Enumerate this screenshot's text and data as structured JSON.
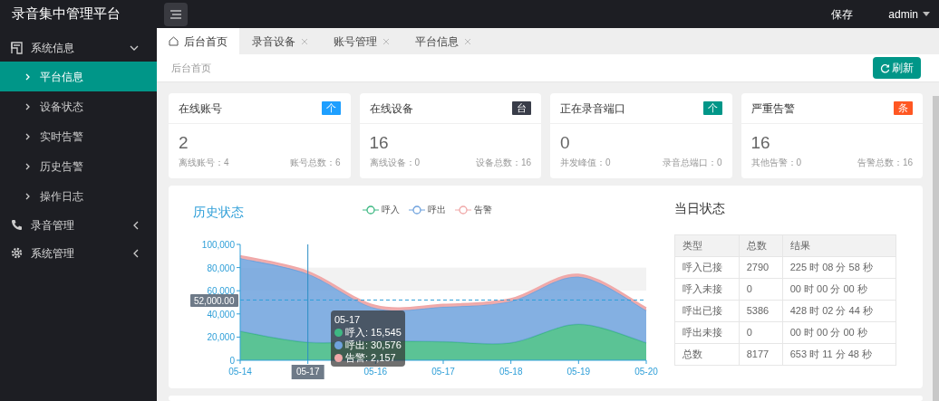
{
  "app_title": "录音集中管理平台",
  "header": {
    "save": "保存",
    "user": "admin"
  },
  "sidebar": {
    "items": [
      {
        "label": "系统信息",
        "expanded": true,
        "children": [
          {
            "label": "平台信息",
            "selected": true
          },
          {
            "label": "设备状态",
            "selected": false
          },
          {
            "label": "实时告警",
            "selected": false
          },
          {
            "label": "历史告警",
            "selected": false
          },
          {
            "label": "操作日志",
            "selected": false
          }
        ]
      },
      {
        "label": "录音管理",
        "expanded": false
      },
      {
        "label": "系统管理",
        "expanded": false
      }
    ]
  },
  "tabs": [
    {
      "label": "后台首页",
      "selected": true,
      "closable": false
    },
    {
      "label": "录音设备",
      "selected": false,
      "closable": true
    },
    {
      "label": "账号管理",
      "selected": false,
      "closable": true
    },
    {
      "label": "平台信息",
      "selected": false,
      "closable": true
    }
  ],
  "breadcrumb": "后台首页",
  "refresh_button": "刷新",
  "stat_cards": [
    {
      "title": "在线账号",
      "badge": "个",
      "color": "#1e9fff",
      "value": "2",
      "left": "离线账号：4",
      "right": "账号总数：6"
    },
    {
      "title": "在线设备",
      "badge": "台",
      "color": "#393d49",
      "value": "16",
      "left": "离线设备：0",
      "right": "设备总数：16"
    },
    {
      "title": "正在录音端口",
      "badge": "个",
      "color": "#009688",
      "value": "0",
      "left": "并发峰值：0",
      "right": "录音总端口：0"
    },
    {
      "title": "严重告警",
      "badge": "条",
      "color": "#ff5722",
      "value": "16",
      "left": "其他告警：0",
      "right": "告警总数：16"
    }
  ],
  "history": {
    "title": "历史状态",
    "mark_line_label": "52,000.00",
    "pointer_label": "05-17",
    "tooltip": {
      "title": "05-17",
      "rows": [
        "呼入: 15,545",
        "呼出: 30,576",
        "告警: 2,157"
      ]
    },
    "chart_data": {
      "type": "area",
      "stacked": true,
      "categories": [
        "05-14",
        null,
        "05-16",
        "05-17",
        "05-18",
        "05-19",
        "05-20"
      ],
      "series": [
        {
          "name": "呼入",
          "color": "#3eb883",
          "values": [
            25000,
            15500,
            16500,
            16000,
            15000,
            31000,
            15000
          ]
        },
        {
          "name": "呼出",
          "color": "#6fa2dd",
          "values": [
            63000,
            59000,
            28500,
            30000,
            36000,
            41000,
            28000
          ]
        },
        {
          "name": "告警",
          "color": "#f0a8a8",
          "values": [
            2000,
            2000,
            2000,
            2000,
            2000,
            2000,
            2000
          ]
        }
      ],
      "ylim": [
        0,
        100000
      ],
      "yticks": [
        {
          "value": 0,
          "label": "0"
        },
        {
          "value": 20000,
          "label": "20,000"
        },
        {
          "value": 40000,
          "label": "40,000"
        },
        {
          "value": 60000,
          "label": "60,000"
        },
        {
          "value": 80000,
          "label": "80,000"
        },
        {
          "value": 100000,
          "label": "100,000"
        }
      ]
    }
  },
  "today": {
    "title": "当日状态",
    "columns": [
      "类型",
      "总数",
      "结果"
    ],
    "rows": [
      [
        "呼入已接",
        "2790",
        "225 时 08 分 58 秒"
      ],
      [
        "呼入未接",
        "0",
        "00 时 00 分 00 秒"
      ],
      [
        "呼出已接",
        "5386",
        "428 时 02 分 44 秒"
      ],
      [
        "呼出未接",
        "0",
        "00 时 00 分 00 秒"
      ],
      [
        "总数",
        "8177",
        "653 时 11 分 48 秒"
      ]
    ]
  }
}
